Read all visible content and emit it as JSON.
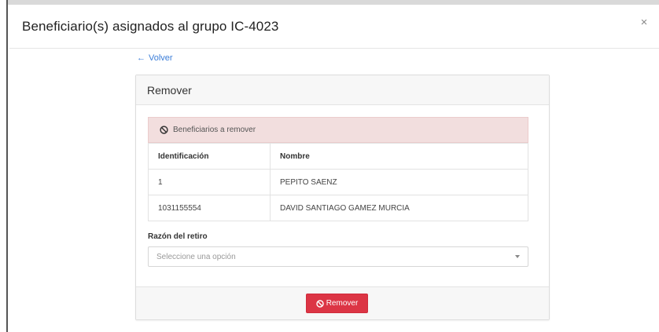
{
  "modal": {
    "title": "Beneficiario(s) asignados al grupo IC-4023",
    "close_label": "×"
  },
  "back_link": {
    "arrow": "←",
    "label": "Volver"
  },
  "card": {
    "header": "Remover",
    "alert_text": "Beneficiarios a remover",
    "table": {
      "columns": [
        "Identificación",
        "Nombre"
      ],
      "rows": [
        [
          "1",
          "PEPITO SAENZ"
        ],
        [
          "1031155554",
          "DAVID SANTIAGO GAMEZ MURCIA"
        ]
      ]
    },
    "reason_label": "Razón del retiro",
    "select_placeholder": "Seleccione una opción",
    "remove_button": "Remover"
  },
  "colors": {
    "danger": "#dc3545",
    "alert_bg": "#f2dede",
    "link": "#3b7dd8"
  }
}
